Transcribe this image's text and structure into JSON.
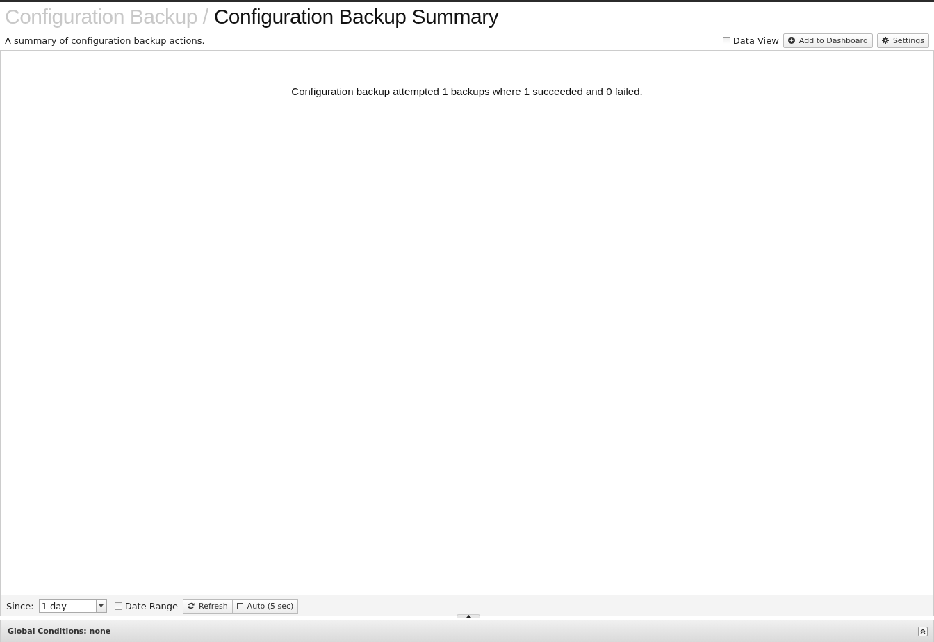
{
  "header": {
    "breadcrumb": "Configuration Backup",
    "separator": "/",
    "title": "Configuration Backup Summary",
    "description": "A summary of configuration backup actions."
  },
  "actions": {
    "data_view": {
      "label": "Data View",
      "checked": false
    },
    "buttons": [
      {
        "label": "Add to Dashboard",
        "kind": "add"
      },
      {
        "label": "Settings",
        "kind": "settings"
      }
    ]
  },
  "message": "Configuration backup attempted 1 backups where 1 succeeded and 0 failed.",
  "toolbar": {
    "since_label": "Since:",
    "since_value": "1 day",
    "date_range": {
      "label": "Date Range",
      "checked": false
    },
    "refresh": "Refresh",
    "auto": {
      "label": "Auto (5 sec)",
      "checked": false
    }
  },
  "global_conditions": "Global Conditions: none"
}
